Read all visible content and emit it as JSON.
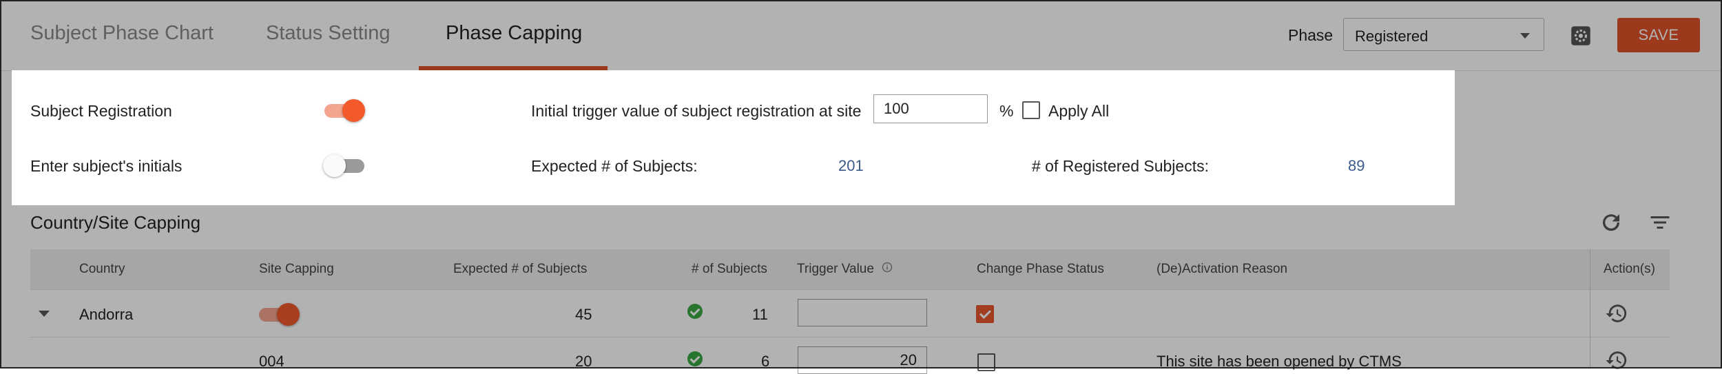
{
  "tabs": [
    {
      "label": "Subject Phase Chart"
    },
    {
      "label": "Status Setting"
    },
    {
      "label": "Phase Capping"
    }
  ],
  "header": {
    "phase_label": "Phase",
    "phase_value": "Registered",
    "save_label": "SAVE"
  },
  "settings": {
    "subject_registration_label": "Subject Registration",
    "subject_registration_on": true,
    "enter_initials_label": "Enter subject's initials",
    "enter_initials_on": false,
    "trigger_label": "Initial trigger value of subject registration at site",
    "trigger_value": "100",
    "percent_sign": "%",
    "apply_all_label": "Apply All",
    "expected_label": "Expected # of Subjects:",
    "expected_value": "201",
    "registered_label": "# of Registered Subjects:",
    "registered_value": "89"
  },
  "capping": {
    "title": "Country/Site Capping",
    "columns": [
      "Country",
      "Site Capping",
      "Expected # of Subjects",
      "# of Subjects",
      "Trigger Value",
      "Change Phase Status",
      "(De)Activation Reason",
      "Action(s)"
    ],
    "rows": [
      {
        "country": "Andorra",
        "expected": "45",
        "subjects": "11",
        "trigger": "",
        "change_status": true,
        "reason": ""
      },
      {
        "country": "004",
        "expected": "20",
        "subjects": "6",
        "trigger": "20",
        "change_status": false,
        "reason": "This site has been opened by CTMS"
      }
    ]
  },
  "colors": {
    "accent": "#e0522a",
    "link": "#3a5a8c",
    "green": "#3aa845"
  },
  "icons": [
    "gear-icon",
    "refresh-icon",
    "filter-icon",
    "info-icon",
    "history-icon",
    "chevron-down-icon"
  ]
}
